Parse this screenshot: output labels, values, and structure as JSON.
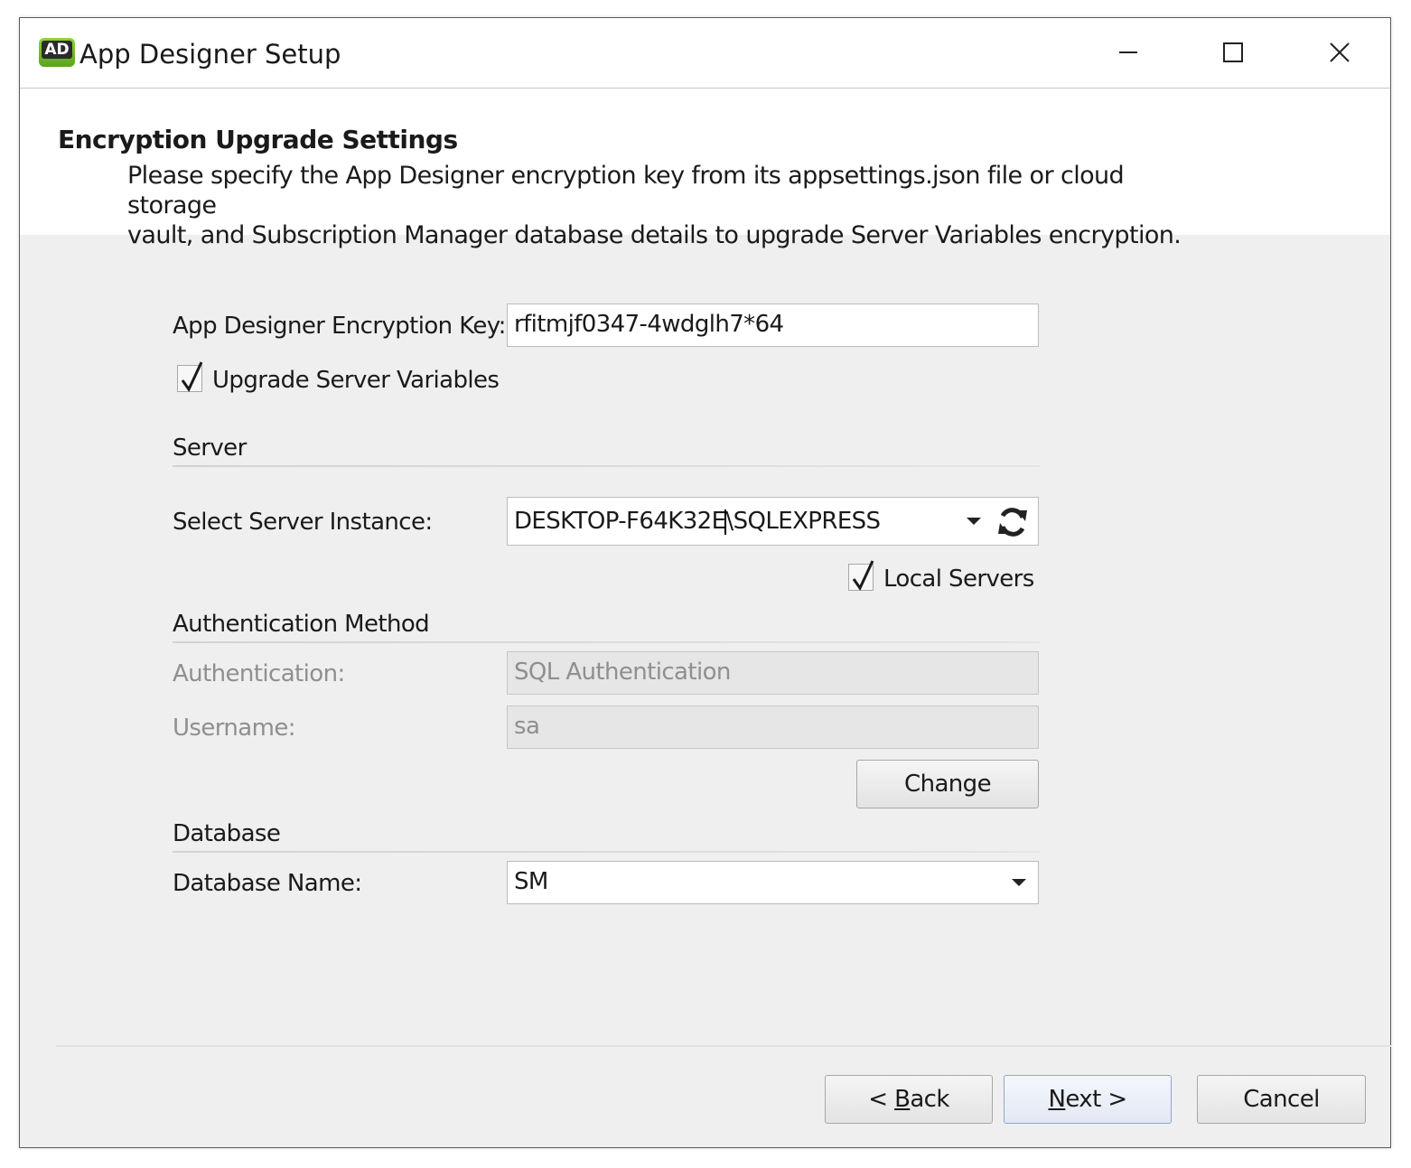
{
  "window": {
    "icon_text": "AD",
    "title": "App Designer Setup"
  },
  "header": {
    "title": "Encryption Upgrade Settings",
    "description_line1": "Please specify the App Designer encryption key from its appsettings.json file or cloud storage",
    "description_line2": "vault, and Subscription Manager database details to upgrade Server Variables encryption."
  },
  "form": {
    "encryption_key_label": "App Designer Encryption Key:",
    "encryption_key_value": "rfitmjf0347-4wdglh7*64",
    "upgrade_server_variables_label": "Upgrade Server Variables",
    "upgrade_server_variables_checked": true,
    "server_section_label": "Server",
    "server_instance_label": "Select Server Instance:",
    "server_instance_value_part1": "DESKTOP-F64K32E",
    "server_instance_value_part2": "\\SQLEXPRESS",
    "local_servers_label": "Local Servers",
    "local_servers_checked": true,
    "auth_section_label": "Authentication Method",
    "authentication_label": "Authentication:",
    "authentication_value": "SQL Authentication",
    "username_label": "Username:",
    "username_value": "sa",
    "change_button": "Change",
    "database_section_label": "Database",
    "database_name_label": "Database Name:",
    "database_name_value": "SM"
  },
  "footer": {
    "back_prefix": "< ",
    "back_underlined": "B",
    "back_rest": "ack",
    "next_underlined": "N",
    "next_rest": "ext >",
    "cancel": "Cancel"
  },
  "icons": {
    "app": "app-designer-logo",
    "refresh": "refresh-icon",
    "dropdown": "chevron-down-icon"
  },
  "colors": {
    "dialog_background": "#efefef",
    "header_background": "#ffffff",
    "disabled_text": "#8f8f8f",
    "primary_button_border": "#8fa7cf"
  }
}
